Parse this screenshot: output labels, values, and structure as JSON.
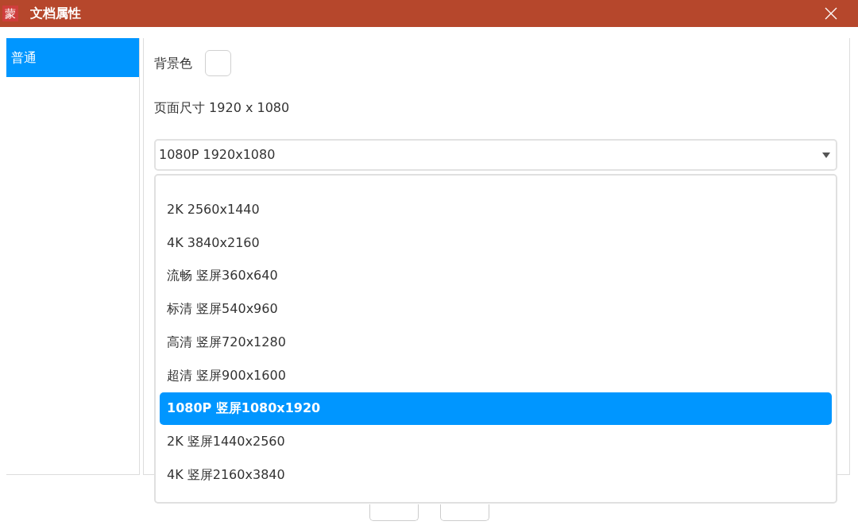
{
  "window": {
    "icon_glyph": "蒙",
    "title": "文档属性"
  },
  "sidebar": {
    "items": [
      {
        "label": "普通",
        "selected": true
      }
    ]
  },
  "background_color": {
    "label": "背景色"
  },
  "page_size": {
    "text": "页面尺寸 1920 x 1080"
  },
  "size_select": {
    "value": "1080P 1920x1080",
    "expanded": true,
    "options": [
      {
        "label": "2K 2560x1440",
        "selected": false
      },
      {
        "label": "4K 3840x2160",
        "selected": false
      },
      {
        "label": "流畅 竖屏360x640",
        "selected": false
      },
      {
        "label": "标清 竖屏540x960",
        "selected": false
      },
      {
        "label": "高清 竖屏720x1280",
        "selected": false
      },
      {
        "label": "超清 竖屏900x1600",
        "selected": false
      },
      {
        "label": "1080P 竖屏1080x1920",
        "selected": true
      },
      {
        "label": "2K 竖屏1440x2560",
        "selected": false
      },
      {
        "label": "4K 竖屏2160x3840",
        "selected": false
      }
    ]
  },
  "footer_buttons": [
    {
      "kind": "push"
    },
    {
      "kind": "push"
    }
  ]
}
